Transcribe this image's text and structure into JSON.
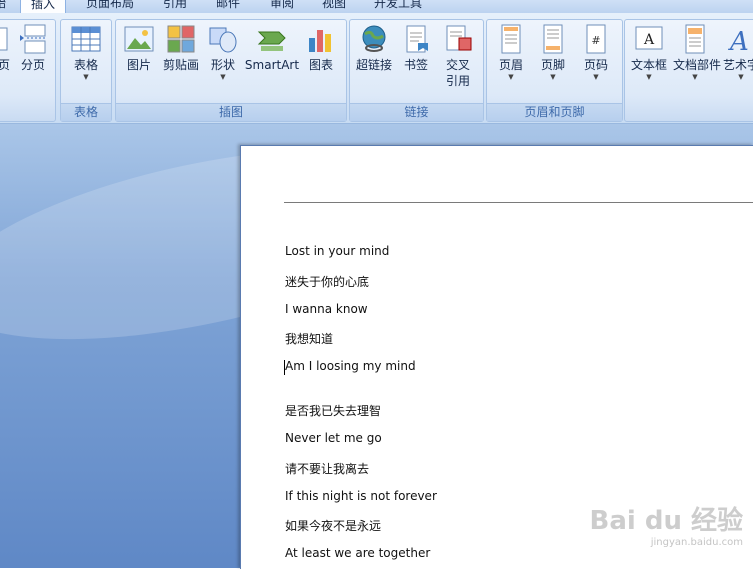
{
  "tabs": [
    {
      "label": "始",
      "active": false
    },
    {
      "label": "插入",
      "active": true
    },
    {
      "label": "页面布局",
      "active": false
    },
    {
      "label": "引用",
      "active": false
    },
    {
      "label": "邮件",
      "active": false
    },
    {
      "label": "审阅",
      "active": false
    },
    {
      "label": "视图",
      "active": false
    },
    {
      "label": "开发工具",
      "active": false
    }
  ],
  "ribbon": {
    "pages_group": {
      "items": [
        {
          "label": "页"
        },
        {
          "label": "分页"
        }
      ]
    },
    "table_group": {
      "label": "表格",
      "items": [
        {
          "label": "表格"
        }
      ]
    },
    "illustrations_group": {
      "label": "插图",
      "items": [
        {
          "label": "图片"
        },
        {
          "label": "剪贴画"
        },
        {
          "label": "形状"
        },
        {
          "label": "SmartArt"
        },
        {
          "label": "图表"
        }
      ]
    },
    "links_group": {
      "label": "链接",
      "items": [
        {
          "label": "超链接"
        },
        {
          "label": "书签"
        },
        {
          "label": "交叉\n引用"
        }
      ]
    },
    "header_footer_group": {
      "label": "页眉和页脚",
      "items": [
        {
          "label": "页眉"
        },
        {
          "label": "页脚"
        },
        {
          "label": "页码"
        }
      ]
    },
    "text_group": {
      "items": [
        {
          "label": "文本框"
        },
        {
          "label": "文档部件"
        },
        {
          "label": "艺术字"
        }
      ]
    }
  },
  "document": {
    "lines": [
      "Lost in your mind",
      "迷失于你的心底",
      "I wanna know",
      "我想知道",
      "Am I loosing my mind",
      "是否我已失去理智",
      "Never let me go",
      "请不要让我离去",
      "If this night is not forever",
      "如果今夜不是永远",
      "At least we are together"
    ]
  },
  "watermark": {
    "main": "Bai du 经验",
    "sub": "jingyan.baidu.com"
  },
  "colors": {
    "accent": "#3e6aaa",
    "ribbon_bg": "#dde9f8",
    "workspace_bg": "#7fa4d6"
  }
}
